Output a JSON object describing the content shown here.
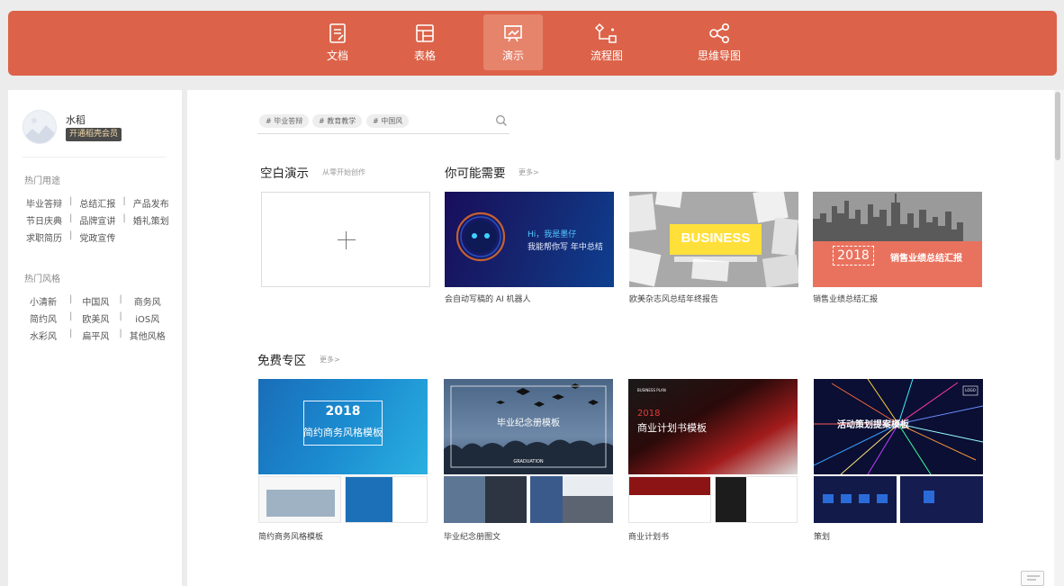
{
  "nav": {
    "tabs": [
      {
        "label": "文档",
        "icon": "document-icon",
        "active": false
      },
      {
        "label": "表格",
        "icon": "table-icon",
        "active": false
      },
      {
        "label": "演示",
        "icon": "presentation-icon",
        "active": true
      },
      {
        "label": "流程图",
        "icon": "flowchart-icon",
        "active": false
      },
      {
        "label": "思维导图",
        "icon": "mindmap-icon",
        "active": false
      }
    ]
  },
  "user": {
    "name": "水稻",
    "vip_label": "开通稻壳会员"
  },
  "sidebar": {
    "usage_title": "热门用途",
    "usage_rows": [
      [
        "毕业答辩",
        "总结汇报",
        "产品发布"
      ],
      [
        "节日庆典",
        "品牌宣讲",
        "婚礼策划"
      ],
      [
        "求职简历",
        "党政宣传"
      ]
    ],
    "style_title": "热门风格",
    "style_rows": [
      [
        "小清新",
        "中国风",
        "商务风"
      ],
      [
        "简约风",
        "欧美风",
        "iOS风"
      ],
      [
        "水彩风",
        "扁平风",
        "其他风格"
      ]
    ]
  },
  "search": {
    "chips": [
      "# 毕业答辩",
      "# 教育教学",
      "# 中国风"
    ]
  },
  "blank": {
    "title": "空白演示",
    "subtitle": "从零开始创作"
  },
  "recommend": {
    "title": "你可能需要",
    "more": "更多>",
    "items": [
      {
        "caption": "会自动写稿的 AI 机器人",
        "line1": "Hi，我是墨仔",
        "line2": "我能帮你写 年中总结"
      },
      {
        "caption": "欧美杂志风总结年终报告",
        "word": "BUSINESS"
      },
      {
        "caption": "销售业绩总结汇报",
        "year": "2018",
        "text": "销售业绩总结汇报"
      }
    ]
  },
  "free": {
    "title": "免费专区",
    "more": "更多>",
    "items": [
      {
        "caption": "简约商务风格模板",
        "year": "2018",
        "text": "简约商务风格模板"
      },
      {
        "caption": "毕业纪念册图文",
        "text": "毕业纪念册模板",
        "sub": "GRADUATION"
      },
      {
        "caption": "商业计划书",
        "tag": "BUSINESS PLAN",
        "year": "2018",
        "text": "商业计划书模板"
      },
      {
        "caption": "策划",
        "text": "活动策划提案模板",
        "logo": "LOGO"
      }
    ]
  },
  "colors": {
    "brand": "#dc6349",
    "brand_active": "#e6836b"
  }
}
